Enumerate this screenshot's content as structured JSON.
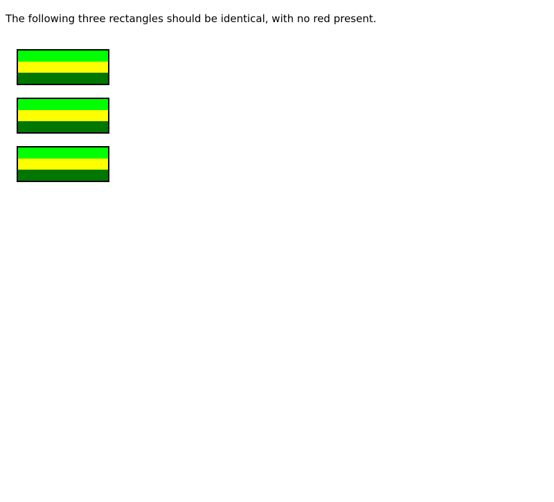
{
  "instruction": "The following three rectangles should be identical, with no red present.",
  "rectangles": [
    {
      "bands": [
        "#00ff00",
        "#ffff00",
        "#007700"
      ]
    },
    {
      "bands": [
        "#00ff00",
        "#ffff00",
        "#007700"
      ]
    },
    {
      "bands": [
        "#00ff00",
        "#ffff00",
        "#007700"
      ]
    }
  ],
  "colors": {
    "border": "#000000",
    "band_top": "#00ff00",
    "band_middle": "#ffff00",
    "band_bottom": "#007700"
  }
}
